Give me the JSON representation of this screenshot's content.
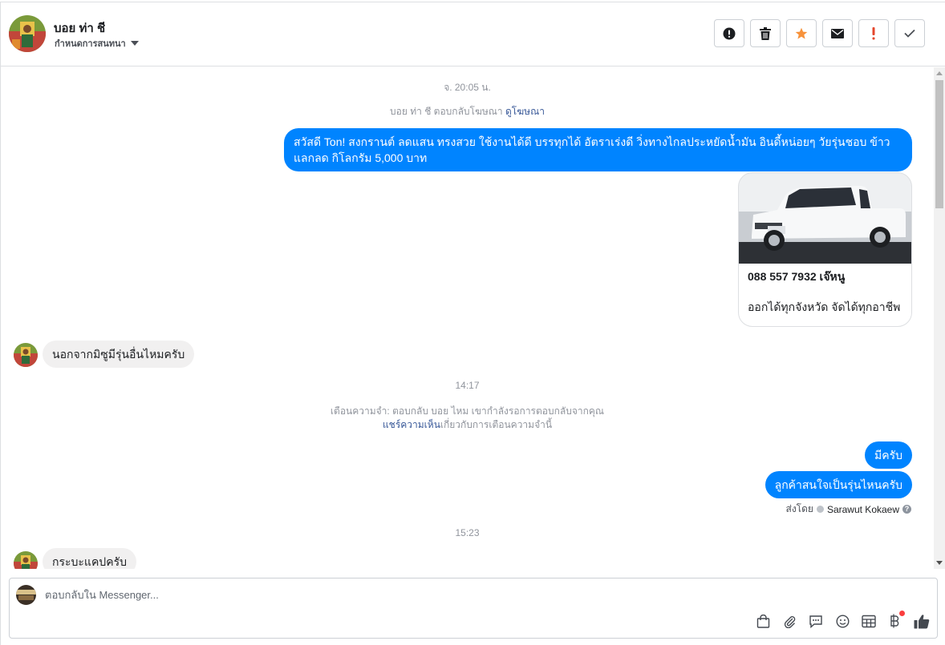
{
  "header": {
    "name": "บอย ท่า ชี",
    "label_dropdown": "กำหนดการสนทนา",
    "actions": [
      {
        "name": "report-icon"
      },
      {
        "name": "trash-icon"
      },
      {
        "name": "star-icon",
        "color": "#f7923b"
      },
      {
        "name": "mail-icon"
      },
      {
        "name": "exclamation-icon",
        "color": "#e4472d"
      },
      {
        "name": "check-icon"
      }
    ]
  },
  "conversation": {
    "timestamp_1": "จ. 20:05 น.",
    "ad_reply_text": "บอย ท่า ชี ตอบกลับโฆษณา",
    "ad_reply_link": "ดูโฆษณา",
    "outgoing_1": "สวัสดี Ton! สงกรานต์ ลดแสน ทรงสวย ใช้งานได้ดี บรรทุกได้ อัตราเร่งดี วิ่งทางไกลประหยัดน้ำมัน อินดี้หน่อยๆ วัยรุ่นชอบ ข้าว แลกลด กิโลกรัม 5,000 บาท",
    "ad_card": {
      "title": "088 557 7932 เจ๊หนู",
      "description": "ออกได้ทุกจังหวัด จัดได้ทุกอาชีพ"
    },
    "incoming_1": "นอกจากมิซูมีรุ่นอื่นไหมครับ",
    "timestamp_2": "14:17",
    "reminder_text": "เตือนความจำ: ตอบกลับ บอย ไหม เขากำลังรอการตอบกลับจากคุณ",
    "reminder_link": "แชร์ความเห็น",
    "reminder_suffix": "เกี่ยวกับการเตือนความจำนี้",
    "outgoing_2": "มีครับ",
    "outgoing_3": "ลูกค้าสนใจเป็นรุ่นไหนครับ",
    "sent_by_label": "ส่งโดย",
    "sent_by_name": "Sarawut Kokaew",
    "timestamp_3": "15:23",
    "incoming_2": "กระบะแคปครับ"
  },
  "composer": {
    "placeholder": "ตอบกลับใน Messenger...",
    "tools": [
      "shopping-bag-icon",
      "paperclip-icon",
      "saved-reply-icon",
      "emoji-icon",
      "table-icon",
      "baht-icon",
      "thumbs-up-icon"
    ]
  },
  "colors": {
    "outgoing_bubble": "#0084ff",
    "incoming_bubble": "#f1f0f0",
    "link": "#385898"
  }
}
